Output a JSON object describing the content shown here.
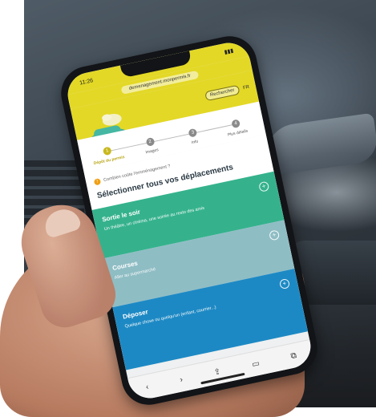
{
  "status_bar": {
    "time": "11:26",
    "signal": ""
  },
  "browser": {
    "url": "demenagement.monpermis.fr"
  },
  "header": {
    "button_label": "Rechercher",
    "language": "FR"
  },
  "steps": [
    {
      "number": "1",
      "label": "Dépôt du permis",
      "active": true
    },
    {
      "number": "2",
      "label": "Images",
      "active": false
    },
    {
      "number": "3",
      "label": "Info",
      "active": false
    },
    {
      "number": "4",
      "label": "Plus détails",
      "active": false
    }
  ],
  "hint": "Combien coûte l'emménagement ?",
  "heading": "Sélectionner tous vos déplacements",
  "cards": [
    {
      "title": "Sortie le soir",
      "desc": "Un théâtre, un cinéma, une soirée au resto des amis",
      "color": "#35b28c"
    },
    {
      "title": "Courses",
      "desc": "Aller au supermarché",
      "color": "#8fbdc4"
    },
    {
      "title": "Déposer",
      "desc": "Quelque chose ou quelqu'un (enfant, courrier...)",
      "color": "#1d89c4"
    }
  ],
  "colors": {
    "brand_yellow": "#e3d826",
    "accent_green": "#35b28c",
    "accent_teal": "#8fbdc4",
    "accent_blue": "#1d89c4"
  },
  "icons": {
    "plus": "plus-circle-icon",
    "hint": "info-icon",
    "back": "chevron-left-icon",
    "forward": "chevron-right-icon",
    "share": "share-icon",
    "bookmarks": "book-icon",
    "tabs": "tabs-icon"
  }
}
